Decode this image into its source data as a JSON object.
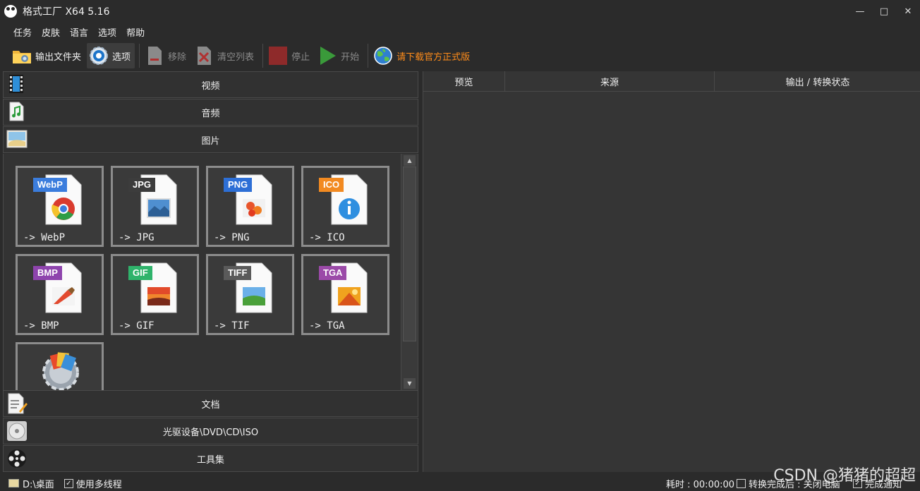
{
  "window": {
    "title": "格式工厂 X64 5.16",
    "minimize": "—",
    "maximize": "□",
    "close": "✕"
  },
  "menu": [
    "任务",
    "皮肤",
    "语言",
    "选项",
    "帮助"
  ],
  "toolbar": {
    "output_folder": "输出文件夹",
    "options": "选项",
    "remove": "移除",
    "clear_list": "清空列表",
    "stop": "停止",
    "start": "开始",
    "download": "请下载官方正式版"
  },
  "categories": {
    "video": "视频",
    "audio": "音频",
    "image": "图片",
    "document": "文档",
    "disc": "光驱设备\\DVD\\CD\\ISO",
    "tools": "工具集"
  },
  "tiles": [
    {
      "tag": "WebP",
      "label": "-> WebP",
      "tag_color": "#3b7ddd"
    },
    {
      "tag": "JPG",
      "label": "-> JPG",
      "tag_color": "#3c3c3c"
    },
    {
      "tag": "PNG",
      "label": "-> PNG",
      "tag_color": "#2d6fd6"
    },
    {
      "tag": "ICO",
      "label": "-> ICO",
      "tag_color": "#f28a21"
    },
    {
      "tag": "BMP",
      "label": "-> BMP",
      "tag_color": "#8e44ad"
    },
    {
      "tag": "GIF",
      "label": "-> GIF",
      "tag_color": "#2fb36b"
    },
    {
      "tag": "TIFF",
      "label": "-> TIF",
      "tag_color": "#5a5a5a"
    },
    {
      "tag": "TGA",
      "label": "-> TGA",
      "tag_color": "#9b4aa8"
    }
  ],
  "columns": {
    "preview": "预览",
    "source": "来源",
    "output_status": "输出 / 转换状态"
  },
  "status": {
    "path": "D:\\桌面",
    "multithread": "使用多线程",
    "elapsed": "耗时 : 00:00:00",
    "after_convert": "转换完成后 : 关闭电脑",
    "notify": "完成通知"
  },
  "watermark": "CSDN @猪猪的超超",
  "colors": {
    "accent_orange": "#ff8c1a",
    "background": "#2b2b2b"
  }
}
